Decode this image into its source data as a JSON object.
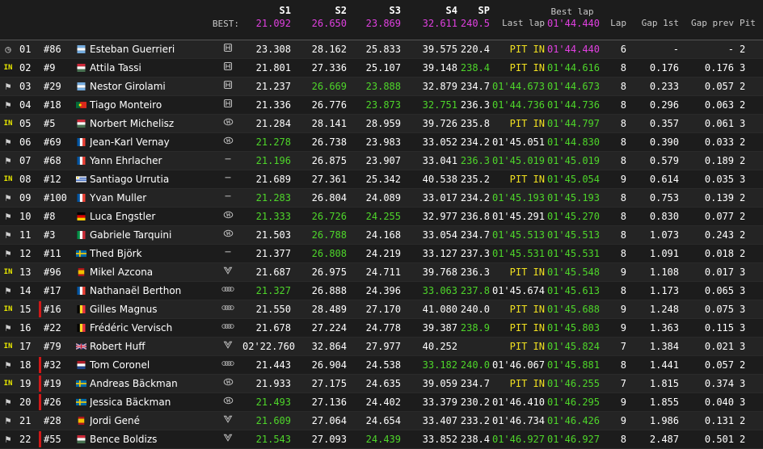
{
  "header": {
    "best_label": "BEST:",
    "columns": {
      "s1": "S1",
      "s2": "S2",
      "s3": "S3",
      "s4": "S4",
      "sp": "SP",
      "last": "Last lap",
      "best": "Best lap",
      "lap": "Lap",
      "gap1": "Gap 1st",
      "gapp": "Gap prev",
      "pit": "Pit"
    },
    "best": {
      "s1": "21.092",
      "s2": "26.650",
      "s3": "23.869",
      "s4": "32.611",
      "sp": "240.5",
      "lap": "01'44.440"
    }
  },
  "colors": {
    "green": "#4ed62a",
    "yellow": "#f0e020",
    "magenta": "#e040e0",
    "white": "#ffffff",
    "accent_bar": "#d01818"
  },
  "rows": [
    {
      "status": "clock",
      "pos": "01",
      "num": "#86",
      "driver": "Esteban Guerrieri",
      "flag": "ar",
      "brand": "honda",
      "s1": "23.308",
      "s2": "28.162",
      "s3": "25.833",
      "s4": "39.575",
      "sp": "220.4",
      "last": "PIT IN",
      "best": "01'44.440",
      "lap": "6",
      "gap1": "-",
      "gapp": "-",
      "pit": "2",
      "c": {
        "s1": "w",
        "s2": "w",
        "s3": "w",
        "s4": "w",
        "sp": "w",
        "last": "y",
        "best": "m"
      },
      "bar": false
    },
    {
      "status": "in",
      "pos": "02",
      "num": "#9",
      "driver": "Attila Tassi",
      "flag": "hu",
      "brand": "honda",
      "s1": "21.801",
      "s2": "27.336",
      "s3": "25.107",
      "s4": "39.148",
      "sp": "238.4",
      "last": "PIT IN",
      "best": "01'44.616",
      "lap": "8",
      "gap1": "0.176",
      "gapp": "0.176",
      "pit": "3",
      "c": {
        "s1": "w",
        "s2": "w",
        "s3": "w",
        "s4": "w",
        "sp": "g",
        "last": "y",
        "best": "g"
      },
      "bar": false
    },
    {
      "status": "flag",
      "pos": "03",
      "num": "#29",
      "driver": "Nestor Girolami",
      "flag": "ar",
      "brand": "honda",
      "s1": "21.237",
      "s2": "26.669",
      "s3": "23.888",
      "s4": "32.879",
      "sp": "234.7",
      "last": "01'44.673",
      "best": "01'44.673",
      "lap": "8",
      "gap1": "0.233",
      "gapp": "0.057",
      "pit": "2",
      "c": {
        "s1": "w",
        "s2": "g",
        "s3": "g",
        "s4": "w",
        "sp": "w",
        "last": "g",
        "best": "g"
      },
      "bar": false
    },
    {
      "status": "flag",
      "pos": "04",
      "num": "#18",
      "driver": "Tiago Monteiro",
      "flag": "pt",
      "brand": "honda",
      "s1": "21.336",
      "s2": "26.776",
      "s3": "23.873",
      "s4": "32.751",
      "sp": "236.3",
      "last": "01'44.736",
      "best": "01'44.736",
      "lap": "8",
      "gap1": "0.296",
      "gapp": "0.063",
      "pit": "2",
      "c": {
        "s1": "w",
        "s2": "w",
        "s3": "g",
        "s4": "g",
        "sp": "w",
        "last": "g",
        "best": "g"
      },
      "bar": false
    },
    {
      "status": "in",
      "pos": "05",
      "num": "#5",
      "driver": "Norbert Michelisz",
      "flag": "hu",
      "brand": "hyundai",
      "s1": "21.284",
      "s2": "28.141",
      "s3": "28.959",
      "s4": "39.726",
      "sp": "235.8",
      "last": "PIT IN",
      "best": "01'44.797",
      "lap": "8",
      "gap1": "0.357",
      "gapp": "0.061",
      "pit": "3",
      "c": {
        "s1": "w",
        "s2": "w",
        "s3": "w",
        "s4": "w",
        "sp": "w",
        "last": "y",
        "best": "g"
      },
      "bar": false
    },
    {
      "status": "flag",
      "pos": "06",
      "num": "#69",
      "driver": "Jean-Karl Vernay",
      "flag": "fr",
      "brand": "hyundai",
      "s1": "21.278",
      "s2": "26.738",
      "s3": "23.983",
      "s4": "33.052",
      "sp": "234.2",
      "last": "01'45.051",
      "best": "01'44.830",
      "lap": "8",
      "gap1": "0.390",
      "gapp": "0.033",
      "pit": "2",
      "c": {
        "s1": "g",
        "s2": "w",
        "s3": "w",
        "s4": "w",
        "sp": "w",
        "last": "w",
        "best": "g"
      },
      "bar": false
    },
    {
      "status": "flag",
      "pos": "07",
      "num": "#68",
      "driver": "Yann Ehrlacher",
      "flag": "fr",
      "brand": "lynk",
      "s1": "21.196",
      "s2": "26.875",
      "s3": "23.907",
      "s4": "33.041",
      "sp": "236.3",
      "last": "01'45.019",
      "best": "01'45.019",
      "lap": "8",
      "gap1": "0.579",
      "gapp": "0.189",
      "pit": "2",
      "c": {
        "s1": "g",
        "s2": "w",
        "s3": "w",
        "s4": "w",
        "sp": "g",
        "last": "g",
        "best": "g"
      },
      "bar": false
    },
    {
      "status": "in",
      "pos": "08",
      "num": "#12",
      "driver": "Santiago Urrutia",
      "flag": "uy",
      "brand": "lynk",
      "s1": "21.689",
      "s2": "27.361",
      "s3": "25.342",
      "s4": "40.538",
      "sp": "235.2",
      "last": "PIT IN",
      "best": "01'45.054",
      "lap": "9",
      "gap1": "0.614",
      "gapp": "0.035",
      "pit": "3",
      "c": {
        "s1": "w",
        "s2": "w",
        "s3": "w",
        "s4": "w",
        "sp": "w",
        "last": "y",
        "best": "g"
      },
      "bar": false
    },
    {
      "status": "flag",
      "pos": "09",
      "num": "#100",
      "driver": "Yvan Muller",
      "flag": "fr",
      "brand": "lynk",
      "s1": "21.283",
      "s2": "26.804",
      "s3": "24.089",
      "s4": "33.017",
      "sp": "234.2",
      "last": "01'45.193",
      "best": "01'45.193",
      "lap": "8",
      "gap1": "0.753",
      "gapp": "0.139",
      "pit": "2",
      "c": {
        "s1": "g",
        "s2": "w",
        "s3": "w",
        "s4": "w",
        "sp": "w",
        "last": "g",
        "best": "g"
      },
      "bar": false
    },
    {
      "status": "flag",
      "pos": "10",
      "num": "#8",
      "driver": "Luca Engstler",
      "flag": "de",
      "brand": "hyundai",
      "s1": "21.333",
      "s2": "26.726",
      "s3": "24.255",
      "s4": "32.977",
      "sp": "236.8",
      "last": "01'45.291",
      "best": "01'45.270",
      "lap": "8",
      "gap1": "0.830",
      "gapp": "0.077",
      "pit": "2",
      "c": {
        "s1": "g",
        "s2": "g",
        "s3": "g",
        "s4": "w",
        "sp": "w",
        "last": "w",
        "best": "g"
      },
      "bar": false
    },
    {
      "status": "flag",
      "pos": "11",
      "num": "#3",
      "driver": "Gabriele Tarquini",
      "flag": "it",
      "brand": "hyundai",
      "s1": "21.503",
      "s2": "26.788",
      "s3": "24.168",
      "s4": "33.054",
      "sp": "234.7",
      "last": "01'45.513",
      "best": "01'45.513",
      "lap": "8",
      "gap1": "1.073",
      "gapp": "0.243",
      "pit": "2",
      "c": {
        "s1": "w",
        "s2": "g",
        "s3": "w",
        "s4": "w",
        "sp": "w",
        "last": "g",
        "best": "g"
      },
      "bar": false
    },
    {
      "status": "flag",
      "pos": "12",
      "num": "#11",
      "driver": "Thed Björk",
      "flag": "se",
      "brand": "lynk",
      "s1": "21.377",
      "s2": "26.808",
      "s3": "24.219",
      "s4": "33.127",
      "sp": "237.3",
      "last": "01'45.531",
      "best": "01'45.531",
      "lap": "8",
      "gap1": "1.091",
      "gapp": "0.018",
      "pit": "2",
      "c": {
        "s1": "w",
        "s2": "g",
        "s3": "w",
        "s4": "w",
        "sp": "w",
        "last": "g",
        "best": "g"
      },
      "bar": false
    },
    {
      "status": "in",
      "pos": "13",
      "num": "#96",
      "driver": "Mikel Azcona",
      "flag": "es",
      "brand": "cupra",
      "s1": "21.687",
      "s2": "26.975",
      "s3": "24.711",
      "s4": "39.768",
      "sp": "236.3",
      "last": "PIT IN",
      "best": "01'45.548",
      "lap": "9",
      "gap1": "1.108",
      "gapp": "0.017",
      "pit": "3",
      "c": {
        "s1": "w",
        "s2": "w",
        "s3": "w",
        "s4": "w",
        "sp": "w",
        "last": "y",
        "best": "g"
      },
      "bar": false
    },
    {
      "status": "flag",
      "pos": "14",
      "num": "#17",
      "driver": "Nathanaël Berthon",
      "flag": "fr",
      "brand": "audi",
      "s1": "21.327",
      "s2": "26.888",
      "s3": "24.396",
      "s4": "33.063",
      "sp": "237.8",
      "last": "01'45.674",
      "best": "01'45.613",
      "lap": "8",
      "gap1": "1.173",
      "gapp": "0.065",
      "pit": "3",
      "c": {
        "s1": "g",
        "s2": "w",
        "s3": "w",
        "s4": "g",
        "sp": "g",
        "last": "w",
        "best": "g"
      },
      "bar": false
    },
    {
      "status": "in",
      "pos": "15",
      "num": "#16",
      "driver": "Gilles Magnus",
      "flag": "be",
      "brand": "audi",
      "s1": "21.550",
      "s2": "28.489",
      "s3": "27.170",
      "s4": "41.080",
      "sp": "240.0",
      "last": "PIT IN",
      "best": "01'45.688",
      "lap": "9",
      "gap1": "1.248",
      "gapp": "0.075",
      "pit": "3",
      "c": {
        "s1": "w",
        "s2": "w",
        "s3": "w",
        "s4": "w",
        "sp": "w",
        "last": "y",
        "best": "g"
      },
      "bar": true
    },
    {
      "status": "flag",
      "pos": "16",
      "num": "#22",
      "driver": "Frédéric Vervisch",
      "flag": "be",
      "brand": "audi",
      "s1": "21.678",
      "s2": "27.224",
      "s3": "24.778",
      "s4": "39.387",
      "sp": "238.9",
      "last": "PIT IN",
      "best": "01'45.803",
      "lap": "9",
      "gap1": "1.363",
      "gapp": "0.115",
      "pit": "3",
      "c": {
        "s1": "w",
        "s2": "w",
        "s3": "w",
        "s4": "w",
        "sp": "g",
        "last": "y",
        "best": "g"
      },
      "bar": false
    },
    {
      "status": "in",
      "pos": "17",
      "num": "#79",
      "driver": "Robert Huff",
      "flag": "gb",
      "brand": "cupra",
      "s1": "02'22.760",
      "s2": "32.864",
      "s3": "27.977",
      "s4": "40.252",
      "sp": "",
      "last": "PIT IN",
      "best": "01'45.824",
      "lap": "7",
      "gap1": "1.384",
      "gapp": "0.021",
      "pit": "3",
      "c": {
        "s1": "w",
        "s2": "w",
        "s3": "w",
        "s4": "w",
        "sp": "w",
        "last": "y",
        "best": "g"
      },
      "bar": false
    },
    {
      "status": "flag",
      "pos": "18",
      "num": "#32",
      "driver": "Tom Coronel",
      "flag": "nl",
      "brand": "audi",
      "s1": "21.443",
      "s2": "26.904",
      "s3": "24.538",
      "s4": "33.182",
      "sp": "240.0",
      "last": "01'46.067",
      "best": "01'45.881",
      "lap": "8",
      "gap1": "1.441",
      "gapp": "0.057",
      "pit": "2",
      "c": {
        "s1": "w",
        "s2": "w",
        "s3": "w",
        "s4": "g",
        "sp": "g",
        "last": "w",
        "best": "g"
      },
      "bar": true
    },
    {
      "status": "in",
      "pos": "19",
      "num": "#19",
      "driver": "Andreas Bäckman",
      "flag": "se",
      "brand": "hyundai",
      "s1": "21.933",
      "s2": "27.175",
      "s3": "24.635",
      "s4": "39.059",
      "sp": "234.7",
      "last": "PIT IN",
      "best": "01'46.255",
      "lap": "7",
      "gap1": "1.815",
      "gapp": "0.374",
      "pit": "3",
      "c": {
        "s1": "w",
        "s2": "w",
        "s3": "w",
        "s4": "w",
        "sp": "w",
        "last": "y",
        "best": "g"
      },
      "bar": true
    },
    {
      "status": "flag",
      "pos": "20",
      "num": "#26",
      "driver": "Jessica Bäckman",
      "flag": "se",
      "brand": "hyundai",
      "s1": "21.493",
      "s2": "27.136",
      "s3": "24.402",
      "s4": "33.379",
      "sp": "230.2",
      "last": "01'46.410",
      "best": "01'46.295",
      "lap": "9",
      "gap1": "1.855",
      "gapp": "0.040",
      "pit": "3",
      "c": {
        "s1": "g",
        "s2": "w",
        "s3": "w",
        "s4": "w",
        "sp": "w",
        "last": "w",
        "best": "g"
      },
      "bar": true
    },
    {
      "status": "flag",
      "pos": "21",
      "num": "#28",
      "driver": "Jordi Gené",
      "flag": "es",
      "brand": "cupra",
      "s1": "21.609",
      "s2": "27.064",
      "s3": "24.654",
      "s4": "33.407",
      "sp": "233.2",
      "last": "01'46.734",
      "best": "01'46.426",
      "lap": "9",
      "gap1": "1.986",
      "gapp": "0.131",
      "pit": "2",
      "c": {
        "s1": "g",
        "s2": "w",
        "s3": "w",
        "s4": "w",
        "sp": "w",
        "last": "w",
        "best": "g"
      },
      "bar": false
    },
    {
      "status": "flag",
      "pos": "22",
      "num": "#55",
      "driver": "Bence Boldizs",
      "flag": "hu",
      "brand": "cupra",
      "s1": "21.543",
      "s2": "27.093",
      "s3": "24.439",
      "s4": "33.852",
      "sp": "238.4",
      "last": "01'46.927",
      "best": "01'46.927",
      "lap": "8",
      "gap1": "2.487",
      "gapp": "0.501",
      "pit": "2",
      "c": {
        "s1": "g",
        "s2": "w",
        "s3": "g",
        "s4": "w",
        "sp": "w",
        "last": "g",
        "best": "g"
      },
      "bar": true
    }
  ]
}
